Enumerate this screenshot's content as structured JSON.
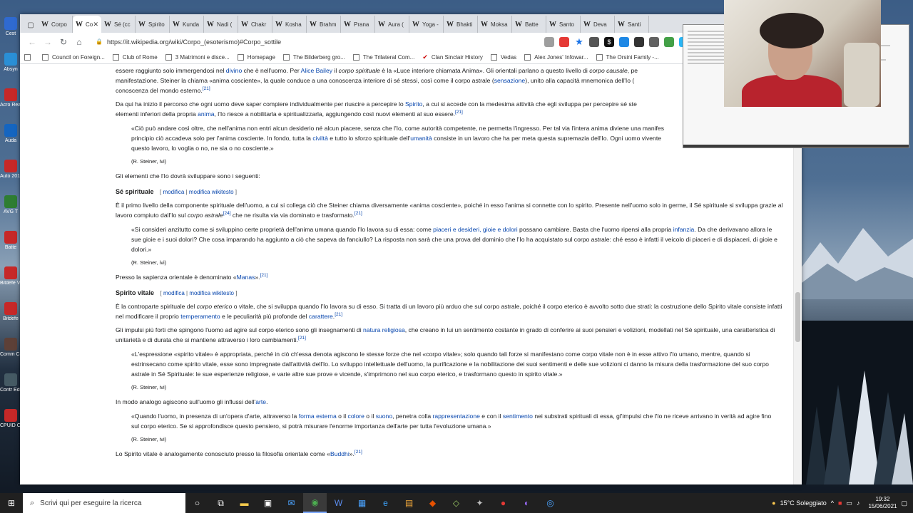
{
  "desktop": {
    "icons": [
      {
        "label": "Cest",
        "color": "#2f6ad0"
      },
      {
        "label": "Absyn",
        "color": "#2a8fd6"
      },
      {
        "label": "Acro Read",
        "color": "#c62828"
      },
      {
        "label": "Auda",
        "color": "#1565c0"
      },
      {
        "label": "Auto 2015",
        "color": "#c62828"
      },
      {
        "label": "AVG T",
        "color": "#2e7d32"
      },
      {
        "label": "Batte",
        "color": "#c62828"
      },
      {
        "label": "Bitdefe VP",
        "color": "#c62828"
      },
      {
        "label": "Bitdefe",
        "color": "#c62828"
      },
      {
        "label": "Comm Conqu",
        "color": "#5d4037"
      },
      {
        "label": "Contr Edit",
        "color": "#455a64"
      },
      {
        "label": "CPUID CPU-",
        "color": "#c62828"
      }
    ]
  },
  "browser": {
    "tabs": [
      {
        "label": "Corpo",
        "active": false
      },
      {
        "label": "Co",
        "active": true
      },
      {
        "label": "Sé (cc",
        "active": false
      },
      {
        "label": "Spirito",
        "active": false
      },
      {
        "label": "Kunda",
        "active": false
      },
      {
        "label": "Nadi (",
        "active": false
      },
      {
        "label": "Chakr",
        "active": false
      },
      {
        "label": "Kosha",
        "active": false
      },
      {
        "label": "Brahm",
        "active": false
      },
      {
        "label": "Prana",
        "active": false
      },
      {
        "label": "Aura (",
        "active": false
      },
      {
        "label": "Yoga -",
        "active": false
      },
      {
        "label": "Bhakti",
        "active": false
      },
      {
        "label": "Moksa",
        "active": false
      },
      {
        "label": "Batte",
        "active": false
      },
      {
        "label": "Santo",
        "active": false
      },
      {
        "label": "Deva",
        "active": false
      },
      {
        "label": "Santi",
        "active": false
      }
    ],
    "url": "https://it.wikipedia.org/wiki/Corpo_(esoterismo)#Corpo_sottile",
    "bookmarks": [
      "Council on Foreign...",
      "Club of Rome",
      "3 Matrimoni e disce...",
      "Homepage",
      "The Bilderberg gro...",
      "The Trilateral Com...",
      "Clan Sinclair History",
      "Vedas",
      "Alex Jones' Infowar...",
      "The Orsini Family -..."
    ]
  },
  "article": {
    "p0": {
      "a": "essere raggiunto solo immergendosi nel ",
      "l1": "divino",
      "b": " che è nell'uomo. Per ",
      "l2": "Alice Bailey",
      "c": " il ",
      "i1": "corpo spirituale",
      "d": " è la «Luce interiore chiamata Anima». Gli orientali parlano a questo livello di ",
      "i2": "corpo causale",
      "e": ", pe",
      "f": "manifestazione. Steiner la chiama «anima cosciente», la quale conduce a una conoscenza interiore di sé stessi, così come il corpo astrale (",
      "l3": "sensazione",
      "g": "), unito alla capacità mnemonica dell'Io (",
      "h": "conoscenza del mondo esterno.",
      "ref": "[21]"
    },
    "p1": {
      "a": "Da qui ha inizio il percorso che ogni uomo deve saper compiere individualmente per riuscire a percepire lo ",
      "l1": "Spirito",
      "b": ", a cui si accede con la medesima attività che egli sviluppa per percepire sé ste",
      "c": "elementi inferiori della propria ",
      "l2": "anima",
      "d": ", l'Io riesce a nobilitarla e spiritualizzarla, aggiungendo così nuovi elementi al suo essere.",
      "ref": "[21]"
    },
    "q1": {
      "a": "«Ciò può andare così oltre, che nell'anima non entri alcun desiderio né alcun piacere, senza che l'Io, come autorità competente, ne permetta l'ingresso. Per tal via l'intera anima diviene una manifes",
      "b": "principio ciò accadeva solo per l'anima cosciente. In fondo, tutta la ",
      "l1": "civiltà",
      "c": " e tutto lo sforzo spirituale dell'",
      "l2": "umanità",
      "d": " consiste in un lavoro che ha per meta questa supremazia dell'Io. Ogni uomo vivente",
      "e": "questo lavoro, lo voglia o no, ne sia o no cosciente.»",
      "cite": "(R. Steiner, ivi)"
    },
    "p2": "Gli elementi che l'Io dovrà sviluppare sono i seguenti:",
    "h_se": "Sé spirituale",
    "edit_open": "[ ",
    "edit_modifica": "modifica",
    "edit_sep": " | ",
    "edit_wikitesto": "modifica wikitesto",
    "edit_close": " ]",
    "p3": {
      "a": "È il primo livello della componente spirituale dell'uomo, a cui si collega ciò che Steiner chiama diversamente «anima cosciente», poiché in esso l'anima si connette con lo spirito. Presente nell'uomo solo in germe, il Sé spirituale si sviluppa grazie al lavoro compiuto dall'Io sul ",
      "i1": "corpo astrale",
      "ref1": "[24]",
      "b": " che ne risulta via via dominato e trasformato.",
      "ref2": "[21]"
    },
    "q2": {
      "a": "«Si consideri anzitutto come si sviluppino certe proprietà dell'anima umana quando l'Io lavora su di essa: come ",
      "l1": "piaceri e desideri, gioie e dolori",
      "b": " possano cambiare. Basta che l'uomo ripensi alla propria ",
      "l2": "infanzia",
      "c": ". Da che derivavano allora le sue gioie e i suoi dolori? Che cosa imparando ha aggiunto a ciò che sapeva da fanciullo? La risposta non sarà che una prova del dominio che l'Io ha acquistato sul corpo astrale: ché esso è infatti il veicolo di piaceri e di dispiaceri, di gioie e dolori.»",
      "cite": "(R. Steiner, ivi)"
    },
    "p4": {
      "a": "Presso la sapienza orientale è denominato «",
      "l1": "Manas",
      "b": "».",
      "ref": "[21]"
    },
    "h_sv": "Spirito vitale",
    "p5": {
      "a": "È la controparte spirituale del ",
      "i1": "corpo eterico",
      "b": " o vitale, che si sviluppa quando l'Io lavora su di esso. Si tratta di un lavoro più arduo che sul corpo astrale, poiché il corpo eterico è avvolto sotto due strati: la costruzione dello Spirito vitale consiste infatti nel modificare il proprio ",
      "l1": "temperamento",
      "c": " e le peculiarità più profonde del ",
      "l2": "carattere",
      "d": ".",
      "ref": "[21]"
    },
    "p6": {
      "a": "Gli impulsi più forti che spingono l'uomo ad agire sul corpo eterico sono gli insegnamenti di ",
      "l1": "natura religiosa",
      "b": ", che creano in lui un sentimento costante in grado di conferire ai suoi pensieri e volizioni, modellati nel Sé spirituale, una caratteristica di unitarietà e di durata che si mantiene attraverso i loro cambiamenti.",
      "ref": "[21]"
    },
    "q3": {
      "text": "«L'espressione «spirito vitale» è appropriata, perché in ciò ch'essa denota agiscono le stesse forze che nel «corpo vitale»; solo quando tali forze si manifestano come corpo vitale non è in esse attivo l'Io umano, mentre, quando si estrinsecano come spirito vitale, esse sono impregnate dall'attività dell'Io. Lo sviluppo intellettuale dell'uomo, la purificazione e la nobilitazione dei suoi sentimenti e delle sue volizioni ci danno la misura della trasformazione del suo corpo astrale in Sé Spirituale: le sue esperienze religiose, e varie altre sue prove e vicende, s'imprimono nel suo corpo eterico, e trasformano questo in spirito vitale.»",
      "cite": "(R. Steiner, ivi)"
    },
    "p7": {
      "a": "In modo analogo agiscono sull'uomo gli influssi dell'",
      "l1": "arte",
      "b": "."
    },
    "q4": {
      "a": "«Quando l'uomo, in presenza di un'opera d'arte, attraverso la ",
      "r1": "forma esterna",
      "b": " o il ",
      "l1": "colore",
      "c": " o il ",
      "l2": "suono",
      "d": ", penetra colla ",
      "l3": "rappresentazione",
      "e": " e con il ",
      "l4": "sentimento",
      "f": " nei substrati spirituali di essa, gl'impulsi che l'Io ne riceve arrivano in verità ad agire fino sul corpo eterico. Se si approfondisce questo pensiero, si potrà misurare l'enorme importanza dell'arte per tutta l'evoluzione umana.»",
      "cite": "(R. Steiner, ivi)"
    },
    "p8": {
      "a": "Lo Spirito vitale è analogamente conosciuto presso la filosofia orientale come «",
      "l1": "Buddhi",
      "b": "».",
      "ref": "[21]"
    }
  },
  "taskbar": {
    "search_placeholder": "Scrivi qui per eseguire la ricerca",
    "weather": "15°C  Soleggiato",
    "time": "19:32",
    "date": "15/06/2021"
  }
}
